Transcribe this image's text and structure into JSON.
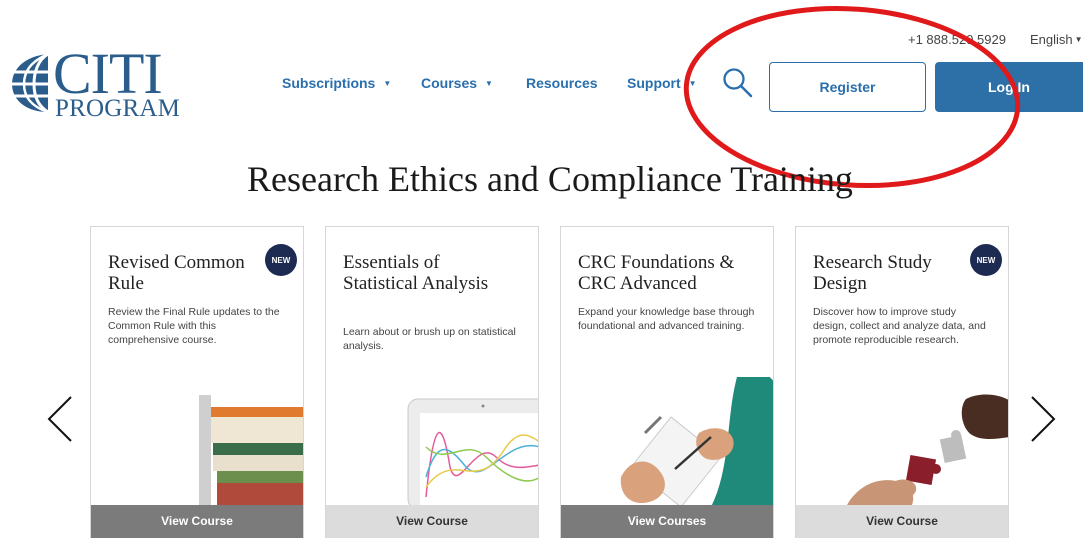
{
  "logo": {
    "main": "CITI",
    "sub": "PROGRAM"
  },
  "utility": {
    "phone": "+1 888.529.5929",
    "language": "English"
  },
  "nav": {
    "subscriptions": "Subscriptions",
    "courses": "Courses",
    "resources": "Resources",
    "support": "Support"
  },
  "icons": {
    "search": "search-icon",
    "arrow_left": "chevron-left-icon",
    "arrow_right": "chevron-right-icon"
  },
  "buttons": {
    "register": "Register",
    "login": "Log In"
  },
  "hero": {
    "title": "Research Ethics and Compliance Training"
  },
  "cards": [
    {
      "title": "Revised Common Rule",
      "description": "Review the Final Rule updates to the Common Rule with this comprehensive course.",
      "badge": "NEW",
      "action": "View Course"
    },
    {
      "title": "Essentials of Statistical Analysis",
      "description": "Learn about or brush up on statistical analysis.",
      "badge": "",
      "action": "View Course"
    },
    {
      "title": "CRC Foundations & CRC Advanced",
      "description": "Expand your knowledge base through foundational and advanced training.",
      "badge": "",
      "action": "View Courses"
    },
    {
      "title": "Research Study Design",
      "description": "Discover how to improve study design, collect and analyze data, and promote reproducible research.",
      "badge": "NEW",
      "action": "View Course"
    }
  ],
  "colors": {
    "brand_blue": "#2a6fad",
    "login_bg": "#2d70a8",
    "badge_navy": "#1d2a52",
    "annotation_red": "#e0191b",
    "view_dark": "#7b7b7b",
    "view_light": "#dcdcdc"
  }
}
